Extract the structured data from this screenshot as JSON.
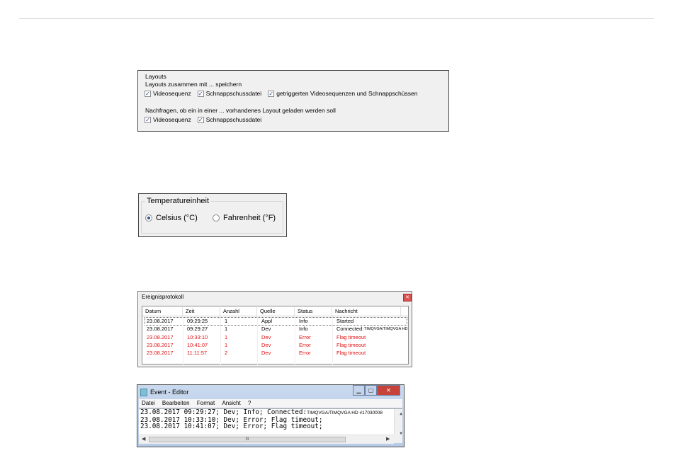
{
  "layouts": {
    "title": "Layouts",
    "save_label": "Layouts zusammen mit ... speichern",
    "save_options": [
      {
        "label": "Videosequenz",
        "checked": true
      },
      {
        "label": "Schnappschussdatei",
        "checked": true
      },
      {
        "label": "getriggerten Videosequenzen und Schnappschüssen",
        "checked": true
      }
    ],
    "ask_label": "Nachfragen, ob ein in einer ... vorhandenes Layout geladen werden soll",
    "ask_options": [
      {
        "label": "Videosequenz",
        "checked": true
      },
      {
        "label": "Schnappschussdatei",
        "checked": true
      }
    ]
  },
  "temperature": {
    "legend": "Temperatureinheit",
    "options": [
      {
        "label": "Celsius (°C)",
        "selected": true
      },
      {
        "label": "Fahrenheit (°F)",
        "selected": false
      }
    ]
  },
  "event_log": {
    "title": "Ereignisprotokoll",
    "columns": [
      "Datum",
      "Zeit",
      "Anzahl",
      "Quelle",
      "Status",
      "Nachricht"
    ],
    "rows": [
      {
        "datum": "23.08.2017",
        "zeit": "09:29:25",
        "anzahl": "1",
        "quelle": "Appl",
        "status": "Info",
        "nachricht": "Started",
        "extra": "",
        "error": false
      },
      {
        "datum": "23.08.2017",
        "zeit": "09:29:27",
        "anzahl": "1",
        "quelle": "Dev",
        "status": "Info",
        "nachricht": "Connected:",
        "extra": "TIMQVGA/TIMQVGA HD",
        "error": false
      },
      {
        "datum": "23.08.2017",
        "zeit": "10:33:10",
        "anzahl": "1",
        "quelle": "Dev",
        "status": "Error",
        "nachricht": "Flag timeout",
        "extra": "",
        "error": true
      },
      {
        "datum": "23.08.2017",
        "zeit": "10:41:07",
        "anzahl": "1",
        "quelle": "Dev",
        "status": "Error",
        "nachricht": "Flag timeout",
        "extra": "",
        "error": true
      },
      {
        "datum": "23.08.2017",
        "zeit": "11:11:57",
        "anzahl": "2",
        "quelle": "Dev",
        "status": "Error",
        "nachricht": "Flag timeout",
        "extra": "",
        "error": true
      }
    ],
    "error_color": "#e01010"
  },
  "editor": {
    "title": "Event - Editor",
    "menu": [
      "Datei",
      "Bearbeiten",
      "Format",
      "Ansicht",
      "?"
    ],
    "line1": "23.08.2017 09:29:27; Dev; Info; Connected:",
    "line1_extra": "TIMQVGA/TIMQVGA HD #17030008",
    "line2": "23.08.2017 10:33:10; Dev; Error; Flag timeout;",
    "line3": "23.08.2017 10:41:07; Dev; Error; Flag timeout;",
    "scroll_thumb": "III"
  }
}
